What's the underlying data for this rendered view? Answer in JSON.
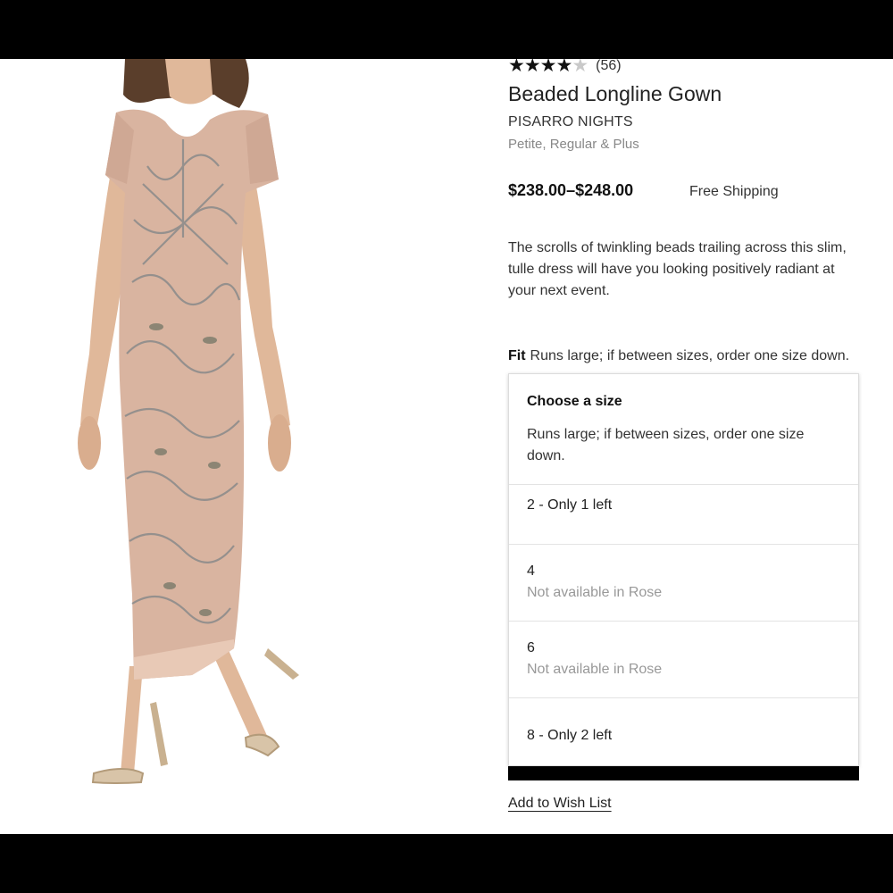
{
  "product": {
    "rating_stars": "★★★★",
    "rating_partial": "★",
    "review_count": "(56)",
    "title": "Beaded Longline Gown",
    "brand": "PISARRO NIGHTS",
    "size_ranges": "Petite, Regular & Plus",
    "price": "$238.00–$248.00",
    "shipping": "Free Shipping",
    "description": "The scrolls of twinkling beads trailing across this slim, tulle dress will have you looking positively radiant at your next event.",
    "fit_label": "Fit",
    "fit_text": "Runs large; if between sizes, order one size down."
  },
  "size_panel": {
    "title": "Choose a size",
    "note": "Runs large; if between sizes, order one size down.",
    "options": [
      {
        "label": "2 - Only 1 left",
        "sub": ""
      },
      {
        "label": "4",
        "sub": "Not available in Rose"
      },
      {
        "label": "6",
        "sub": "Not available in Rose"
      },
      {
        "label": "8 - Only 2 left",
        "sub": ""
      }
    ]
  },
  "wishlist_label": "Add to Wish List",
  "colors": {
    "dress": "#d9b4a0",
    "beading": "#8a8a8a",
    "skin": "#e0b89a",
    "hair": "#5a3e2b"
  },
  "icons": {
    "rating": "star-icon"
  }
}
